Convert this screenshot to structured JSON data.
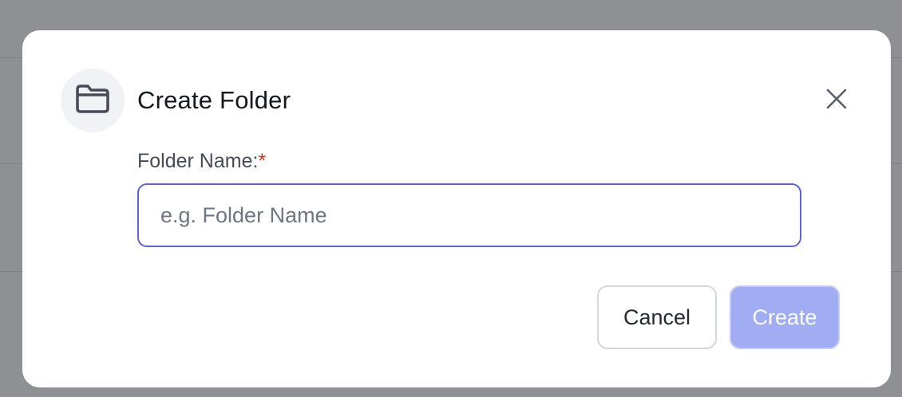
{
  "dialog": {
    "title": "Create Folder",
    "icon": "folder-icon",
    "close_icon": "close-icon"
  },
  "field": {
    "label": "Folder Name:",
    "required_marker": "*",
    "value": "",
    "placeholder": "e.g. Folder Name"
  },
  "actions": {
    "cancel_label": "Cancel",
    "create_label": "Create",
    "create_disabled": true
  },
  "colors": {
    "overlay": "#8f9093",
    "input_focus_border": "#5b63d6",
    "create_disabled_bg": "#a1adf2",
    "required": "#c0392b"
  }
}
